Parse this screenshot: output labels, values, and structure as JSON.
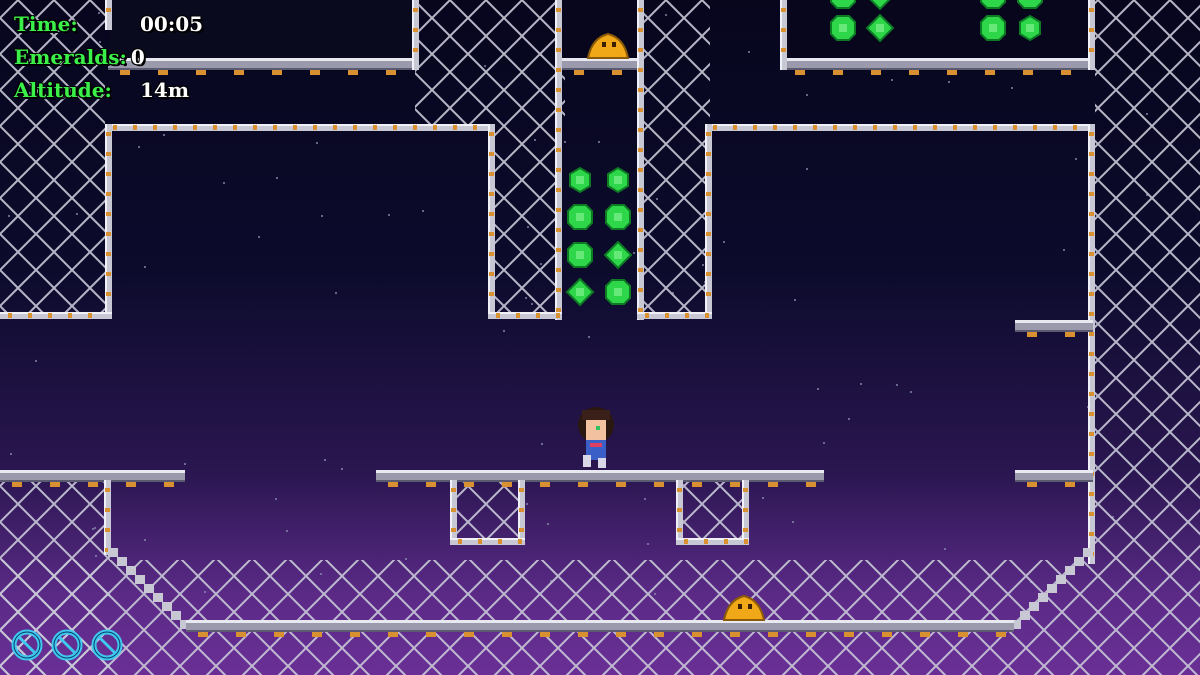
{
  "hud": {
    "time_label": "Time:",
    "time_value": "00:05",
    "emeralds_label": "Emeralds:",
    "emeralds_value": "0",
    "altitude_label": "Altitude:",
    "altitude_value": "14m"
  },
  "lives": {
    "count": 3,
    "icon": "ring-life-icon",
    "color": "#3ec8f0"
  },
  "colors": {
    "sky_top": "#07061d",
    "sky_bottom": "#6a2f96",
    "fence": "#c8c8d8",
    "girder": "#b8b8c8",
    "bolt": "#d89030",
    "emerald": "#2ed64a",
    "slime": "#f0a818",
    "hud_label": "#3cf04a"
  },
  "entities": {
    "player": "player-girl-sprite",
    "enemy": "slime-blob-sprite",
    "collectible": "emerald-gem-icon"
  }
}
